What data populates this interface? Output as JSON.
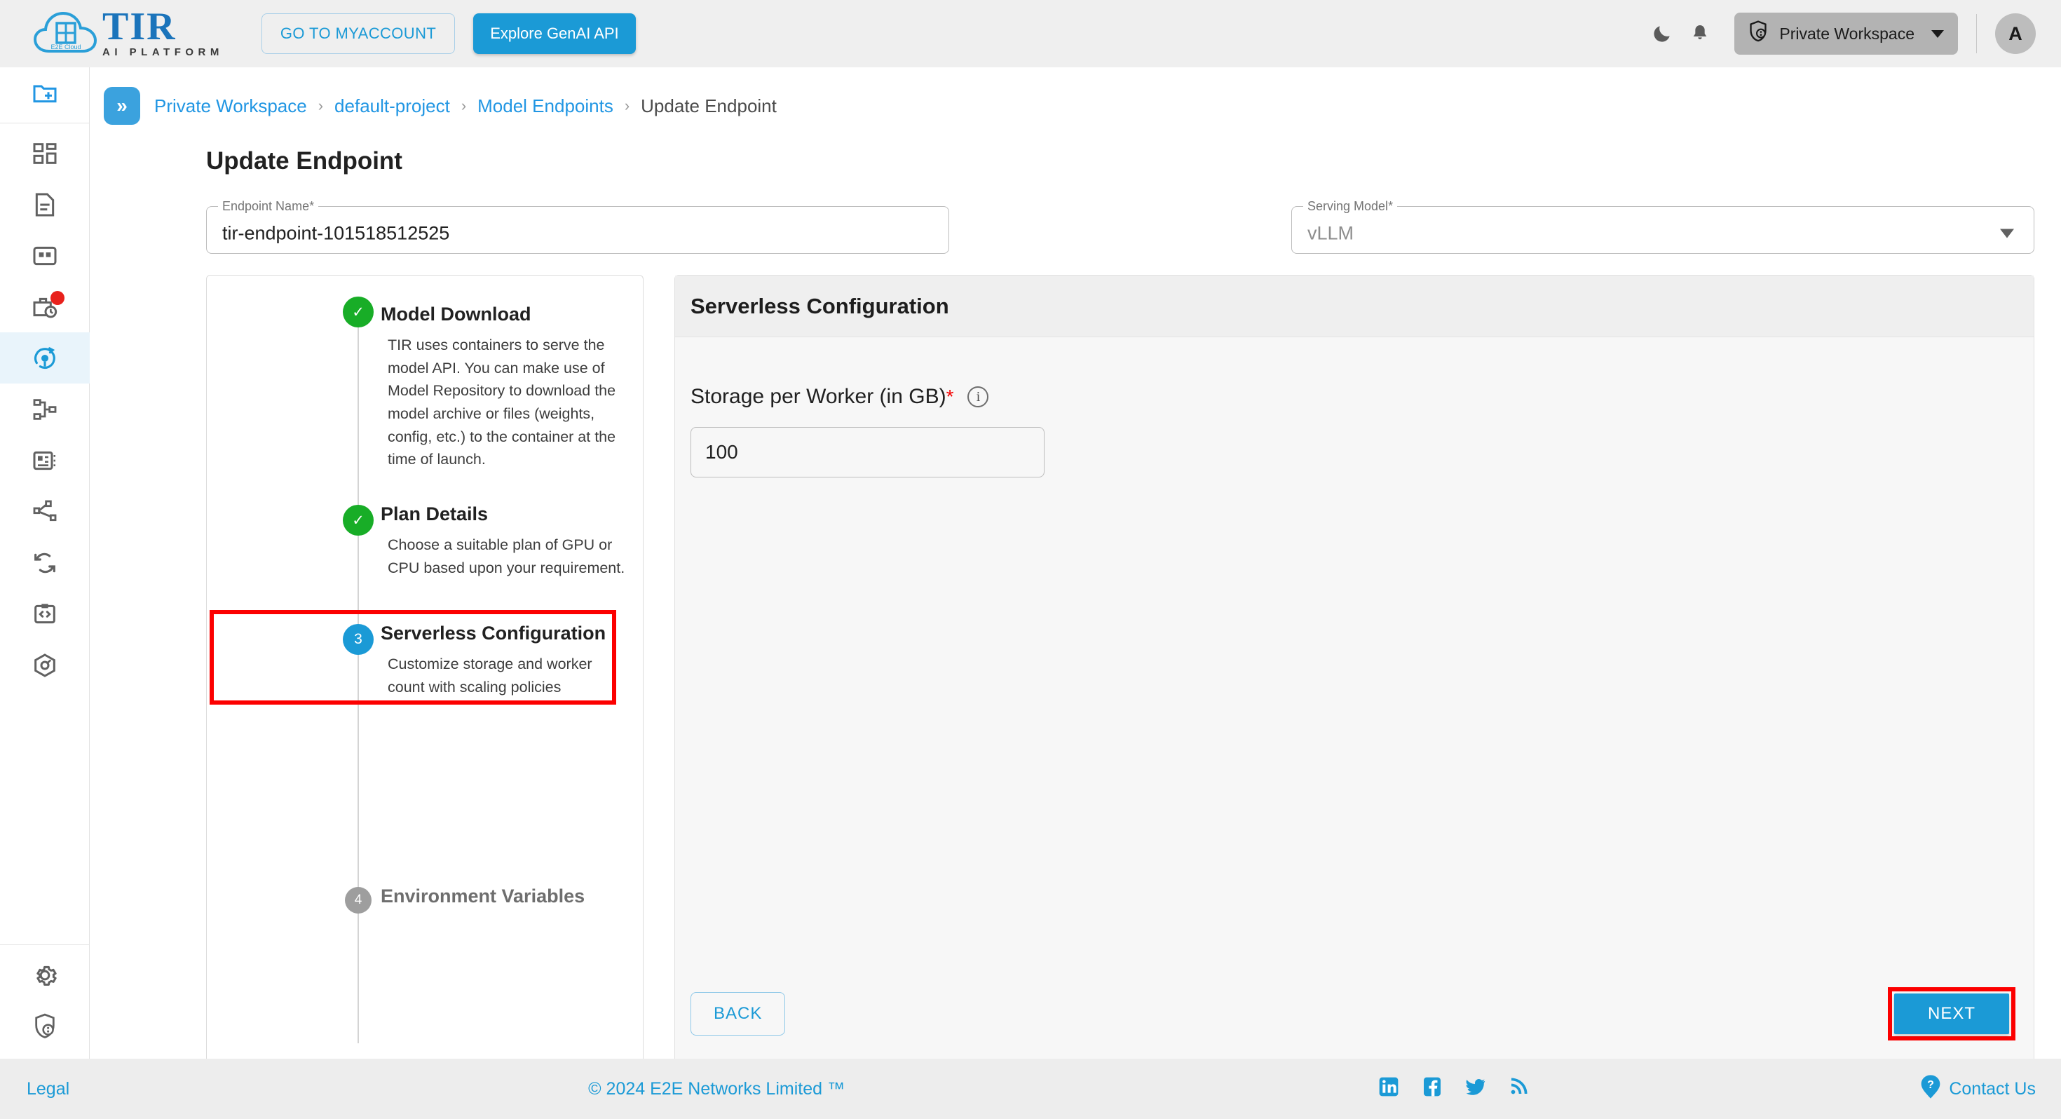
{
  "topbar": {
    "logo_name": "TIR",
    "logo_subtitle": "AI PLATFORM",
    "logo_badge": "E2E Cloud",
    "myaccount_label": "GO TO MYACCOUNT",
    "genai_label": "Explore GenAI API",
    "dark_mode_icon": "moon-icon",
    "notification_icon": "bell-icon",
    "workspace_icon": "shield-user-icon",
    "workspace_label": "Private Workspace",
    "avatar_initial": "A"
  },
  "rail": {
    "items": [
      {
        "name": "new-project-icon",
        "active": false,
        "badge": false
      },
      {
        "name": "dashboard-icon",
        "active": false,
        "badge": false
      },
      {
        "name": "notebook-icon",
        "active": false,
        "badge": false
      },
      {
        "name": "datasets-icon",
        "active": false,
        "badge": false
      },
      {
        "name": "jobs-icon",
        "active": false,
        "badge": true
      },
      {
        "name": "model-endpoints-icon",
        "active": true,
        "badge": false
      },
      {
        "name": "pipelines-icon",
        "active": false,
        "badge": false
      },
      {
        "name": "model-repository-icon",
        "active": false,
        "badge": false
      },
      {
        "name": "integrations-icon",
        "active": false,
        "badge": false
      },
      {
        "name": "sync-icon",
        "active": false,
        "badge": false
      },
      {
        "name": "api-tokens-icon",
        "active": false,
        "badge": false
      },
      {
        "name": "containers-icon",
        "active": false,
        "badge": false
      }
    ],
    "bottom": [
      {
        "name": "settings-gear-icon"
      },
      {
        "name": "security-shield-icon"
      }
    ]
  },
  "breadcrumb": {
    "collapse_icon": "chevron-double-right-icon",
    "items": [
      {
        "label": "Private Workspace",
        "current": false
      },
      {
        "label": "default-project",
        "current": false
      },
      {
        "label": "Model Endpoints",
        "current": false
      },
      {
        "label": "Update Endpoint",
        "current": true
      }
    ],
    "separator": "›"
  },
  "page": {
    "title": "Update Endpoint"
  },
  "form": {
    "endpoint_name": {
      "label": "Endpoint Name",
      "required_mark": "*",
      "value": "tir-endpoint-101518512525"
    },
    "serving_model": {
      "label": "Serving Model",
      "required_mark": "*",
      "value": "vLLM"
    }
  },
  "stepper": {
    "steps": [
      {
        "number": "1",
        "state": "done",
        "marker": "✓",
        "title": "Model Download",
        "description": "TIR uses containers to serve the model API. You can make use of Model Repository to download the model archive or files (weights, config, etc.) to the container at the time of launch."
      },
      {
        "number": "2",
        "state": "done",
        "marker": "✓",
        "title": "Plan Details",
        "description": "Choose a suitable plan of GPU or CPU based upon your requirement."
      },
      {
        "number": "3",
        "state": "current",
        "marker": "3",
        "title": "Serverless Configuration",
        "description": "Customize storage and worker count with scaling policies"
      },
      {
        "number": "4",
        "state": "todo",
        "marker": "4",
        "title": "Environment Variables",
        "description": ""
      }
    ],
    "highlight_color": "#fc0000"
  },
  "config": {
    "header": "Serverless Configuration",
    "storage_label": "Storage per Worker (in GB)",
    "storage_required_mark": "*",
    "storage_info_icon": "info-circle-icon",
    "storage_value": "100",
    "back_label": "BACK",
    "next_label": "NEXT"
  },
  "footer": {
    "legal": "Legal",
    "copyright": "© 2024 E2E Networks Limited ™",
    "social": [
      "linkedin-icon",
      "facebook-icon",
      "twitter-icon",
      "rss-icon"
    ],
    "contact_icon": "help-circle-icon",
    "contact_label": "Contact Us"
  },
  "colors": {
    "accent": "#1b9ad6",
    "link": "#2196e3",
    "done": "#18ad27",
    "highlight": "#fc0000",
    "badge": "#e8211c"
  }
}
